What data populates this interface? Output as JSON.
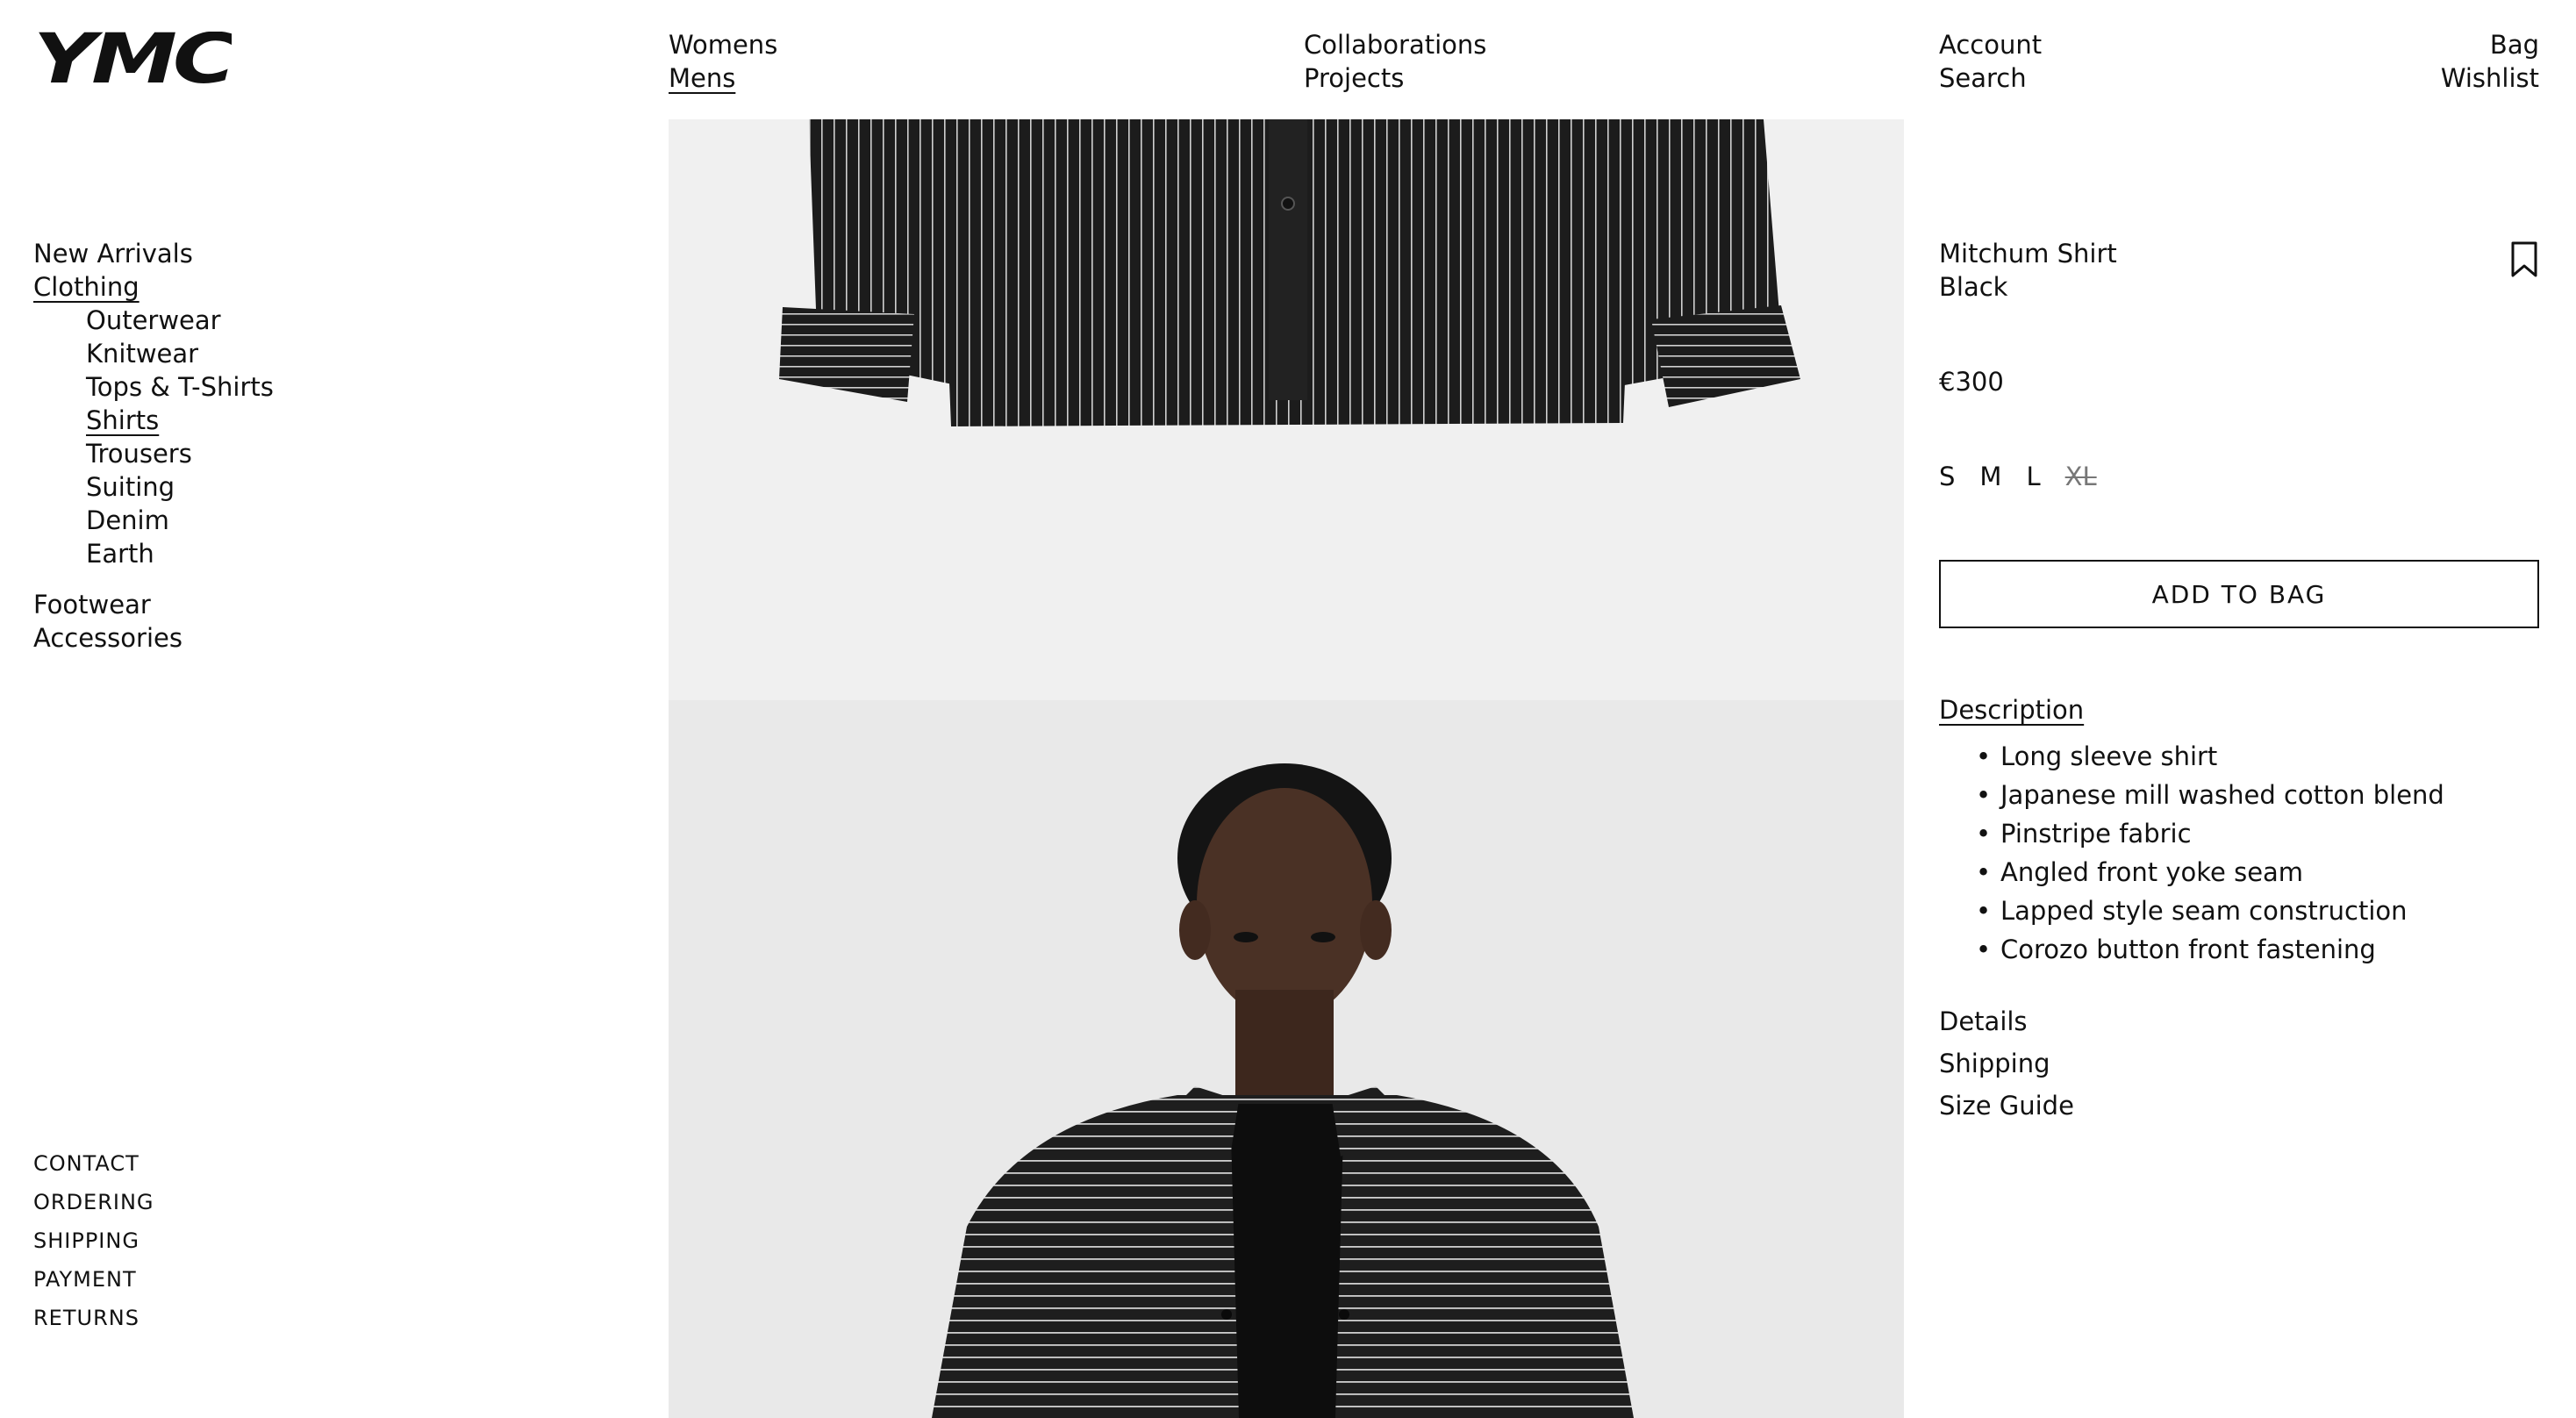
{
  "brand": {
    "logo_text": "YMC"
  },
  "topnav": {
    "col1": [
      "Womens",
      "Mens"
    ],
    "col2": [
      "Collaborations",
      "Projects"
    ],
    "col3": [
      "Account",
      "Search"
    ],
    "col4": [
      "Bag",
      "Wishlist"
    ]
  },
  "sidebar": {
    "new_arrivals": "New Arrivals",
    "clothing": "Clothing",
    "clothing_items": [
      "Outerwear",
      "Knitwear",
      "Tops & T-Shirts",
      "Shirts",
      "Trousers",
      "Suiting",
      "Denim",
      "Earth"
    ],
    "footwear": "Footwear",
    "accessories": "Accessories"
  },
  "footer_links": [
    "CONTACT",
    "ORDERING",
    "SHIPPING",
    "PAYMENT",
    "RETURNS"
  ],
  "product": {
    "name": "Mitchum Shirt",
    "color": "Black",
    "price": "€300",
    "sizes": [
      "S",
      "M",
      "L",
      "XL"
    ],
    "sizes_unavailable": [
      "XL"
    ],
    "add_to_bag": "ADD TO BAG",
    "description_title": "Description",
    "description_items": [
      "Long sleeve shirt",
      "Japanese mill washed cotton blend",
      "Pinstripe fabric",
      "Angled front yoke seam",
      "Lapped style seam construction",
      "Corozo button front fastening"
    ],
    "more_links": [
      "Details",
      "Shipping",
      "Size Guide"
    ]
  },
  "colors": {
    "text": "#111111",
    "image_bg": "#efefef",
    "shirt": "#1c1c1c"
  },
  "icons": {
    "bookmark": "bookmark-icon"
  }
}
